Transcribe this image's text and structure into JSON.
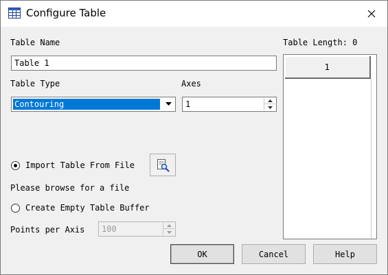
{
  "window": {
    "title": "Configure Table"
  },
  "form": {
    "table_name_label": "Table Name",
    "table_name_value": "Table 1",
    "table_type_label": "Table Type",
    "table_type_value": "Contouring",
    "axes_label": "Axes",
    "axes_value": "1",
    "import_option_label": "Import Table From File",
    "browse_hint": "Please browse for a file",
    "empty_option_label": "Create Empty Table Buffer",
    "points_label": "Points per Axis",
    "points_value": "100",
    "selected_option": "import"
  },
  "table_panel": {
    "length_label": "Table Length: 0",
    "column_header": "1"
  },
  "buttons": {
    "ok": "OK",
    "cancel": "Cancel",
    "help": "Help"
  },
  "icons": {
    "app": "table-icon",
    "close": "close-icon",
    "browse": "magnifier-document-icon",
    "dropdown": "chevron-down-icon"
  }
}
